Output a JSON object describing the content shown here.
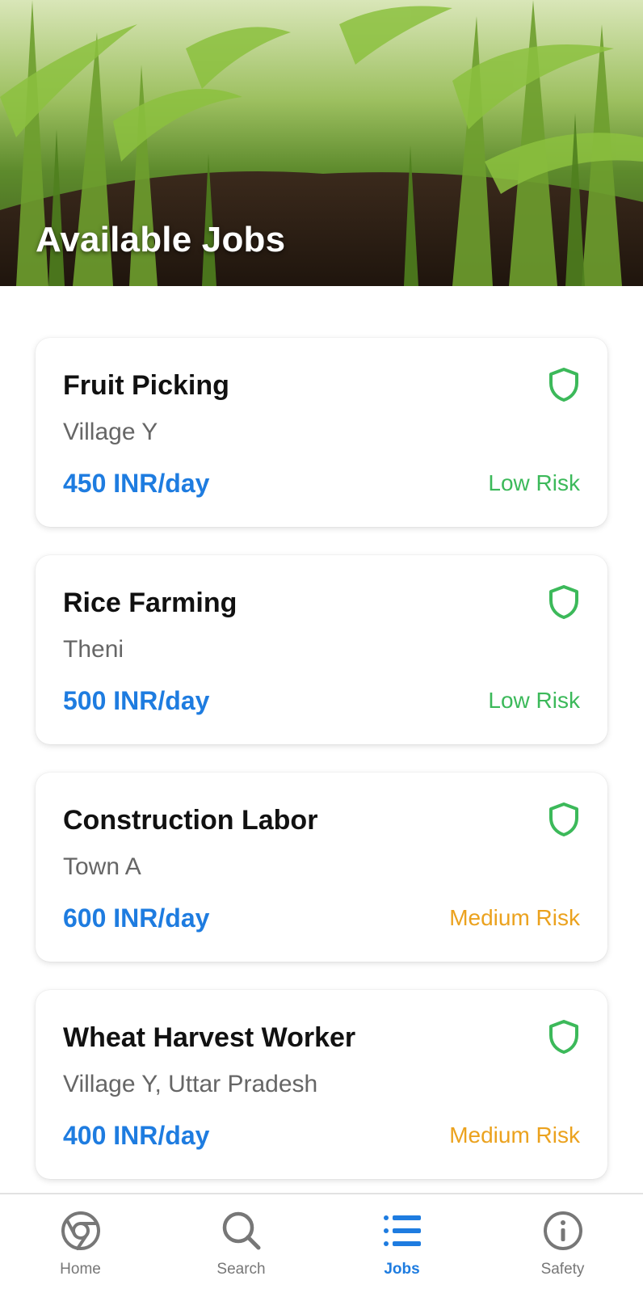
{
  "header": {
    "title": "Available Jobs"
  },
  "jobs": [
    {
      "title": "Fruit Picking",
      "location": "Village Y",
      "pay": "450 INR/day",
      "risk": "Low Risk",
      "risk_level": "low"
    },
    {
      "title": "Rice Farming",
      "location": "Theni",
      "pay": "500 INR/day",
      "risk": "Low Risk",
      "risk_level": "low"
    },
    {
      "title": "Construction Labor",
      "location": "Town A",
      "pay": "600 INR/day",
      "risk": "Medium Risk",
      "risk_level": "medium"
    },
    {
      "title": "Wheat Harvest Worker",
      "location": "Village Y, Uttar Pradesh",
      "pay": "400 INR/day",
      "risk": "Medium Risk",
      "risk_level": "medium"
    }
  ],
  "nav": {
    "items": [
      {
        "label": "Home",
        "icon": "chrome-icon",
        "active": false
      },
      {
        "label": "Search",
        "icon": "search-icon",
        "active": false
      },
      {
        "label": "Jobs",
        "icon": "list-icon",
        "active": true
      },
      {
        "label": "Safety",
        "icon": "info-icon",
        "active": false
      }
    ]
  },
  "colors": {
    "accent": "#1e7ce0",
    "low_risk": "#3cb95a",
    "medium_risk": "#eba21e",
    "shield": "#3cb95a"
  }
}
